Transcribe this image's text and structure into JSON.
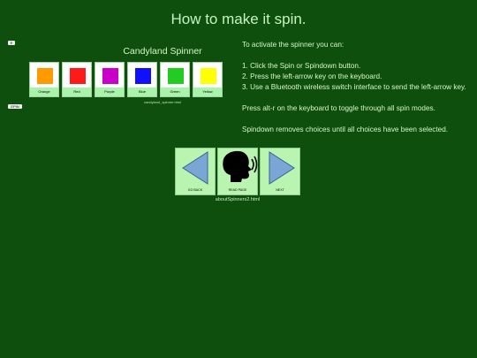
{
  "page": {
    "title": "How to make it spin."
  },
  "small_buttons": {
    "top": "E",
    "bottom": "EPIN"
  },
  "spinner": {
    "title": "Candyland Spinner",
    "caption": "candyland_spinner.html",
    "choices": [
      {
        "label": "Orange",
        "color": "#ff9a00"
      },
      {
        "label": "Red",
        "color": "#ff1a1a"
      },
      {
        "label": "Purple",
        "color": "#c800c8"
      },
      {
        "label": "Blue",
        "color": "#1010ff"
      },
      {
        "label": "Green",
        "color": "#22cc22"
      },
      {
        "label": "Yellow",
        "color": "#ffff00"
      }
    ]
  },
  "instructions": {
    "intro": "To activate the spinner you can:",
    "steps": [
      "1. Click the Spin or Spindown button.",
      "2. Press the left-arrow key on the keyboard.",
      "3. Use a Bluetooth wireless switch interface to send the left-arrow key."
    ],
    "tip1": "Press alt-r on the keyboard to toggle through all spin modes.",
    "tip2": "Spindown removes choices until all choices have been selected."
  },
  "nav": {
    "back_label": "GO BACK",
    "read_label": "READ PAGE",
    "next_label": "NEXT",
    "link": "aboutSpinners2.html"
  },
  "colors": {
    "background": "#0e4f0e",
    "button": "#b9f5b0",
    "arrow": "#7aa6d6"
  }
}
